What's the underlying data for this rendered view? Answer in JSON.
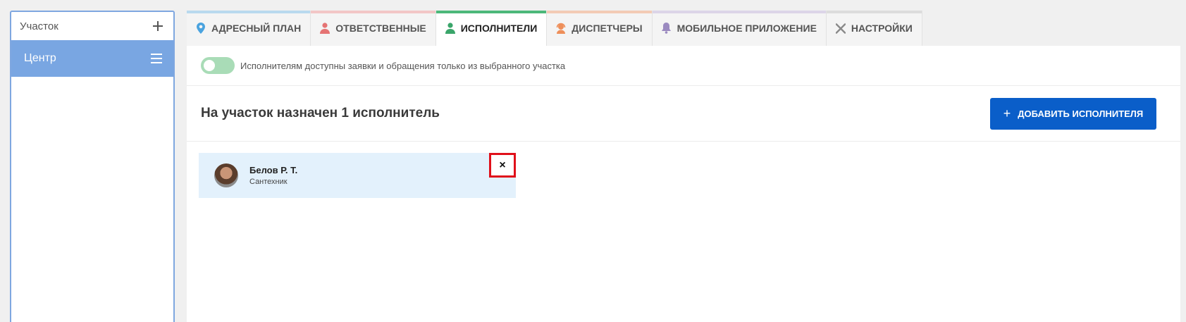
{
  "sidebar": {
    "header_label": "Участок",
    "items": [
      {
        "label": "Центр"
      }
    ]
  },
  "tabs": [
    {
      "label": "АДРЕСНЫЙ ПЛАН",
      "color": "#b9d9ee",
      "icon": "map-pin-icon",
      "icon_color": "#4aa3df"
    },
    {
      "label": "ОТВЕТСТВЕННЫЕ",
      "color": "#f2c6c6",
      "icon": "user-icon",
      "icon_color": "#e57373"
    },
    {
      "label": "ИСПОЛНИТЕЛИ",
      "color": "#4cb87a",
      "icon": "user-icon",
      "icon_color": "#3aa56a"
    },
    {
      "label": "ДИСПЕТЧЕРЫ",
      "color": "#f3cbb5",
      "icon": "headset-icon",
      "icon_color": "#ee8f5a"
    },
    {
      "label": "МОБИЛЬНОЕ ПРИЛОЖЕНИЕ",
      "color": "#dcd5e8",
      "icon": "bell-icon",
      "icon_color": "#9b8ac0"
    },
    {
      "label": "НАСТРОЙКИ",
      "color": "#dcdcdc",
      "icon": "tools-icon",
      "icon_color": "#888888"
    }
  ],
  "active_tab": "ИСПОЛНИТЕЛИ",
  "toggle": {
    "label": "Исполнителям доступны заявки и обращения только из выбранного участка",
    "state": "on"
  },
  "assigned": {
    "title": "На участок назначен 1 исполнитель",
    "add_button_label": "ДОБАВИТЬ ИСПОЛНИТЕЛЯ"
  },
  "executors": [
    {
      "name": "Белов Р. Т.",
      "role": "Сантехник"
    }
  ],
  "remove_label": "×"
}
